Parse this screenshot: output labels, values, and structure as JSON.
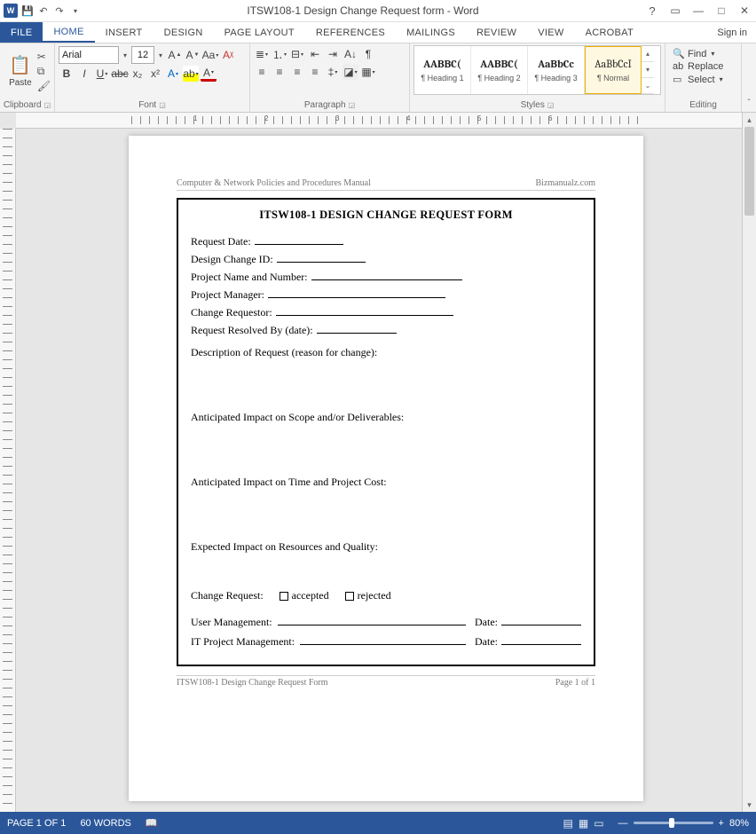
{
  "title": "ITSW108-1 Design Change Request form - Word",
  "window": {
    "help": "?",
    "ropt": "▭",
    "min": "—",
    "max": "□",
    "close": "✕"
  },
  "tabs": {
    "file": "FILE",
    "home": "HOME",
    "insert": "INSERT",
    "design": "DESIGN",
    "pagelayout": "PAGE LAYOUT",
    "references": "REFERENCES",
    "mailings": "MAILINGS",
    "review": "REVIEW",
    "view": "VIEW",
    "acrobat": "ACROBAT",
    "signin": "Sign in"
  },
  "ribbon": {
    "clipboard": {
      "paste": "Paste",
      "label": "Clipboard"
    },
    "font": {
      "name": "Arial",
      "size": "12",
      "label": "Font"
    },
    "paragraph": {
      "label": "Paragraph"
    },
    "styles": {
      "label": "Styles",
      "items": [
        {
          "prev": "AABBC(",
          "name": "¶ Heading 1",
          "bold": true
        },
        {
          "prev": "AABBC(",
          "name": "¶ Heading 2",
          "bold": true
        },
        {
          "prev": "AaBbCc",
          "name": "¶ Heading 3",
          "bold": true
        },
        {
          "prev": "AaBbCcI",
          "name": "¶ Normal",
          "bold": false
        }
      ]
    },
    "editing": {
      "find": "Find",
      "replace": "Replace",
      "select": "Select",
      "label": "Editing"
    }
  },
  "doc": {
    "hdr_left": "Computer & Network Policies and Procedures Manual",
    "hdr_right": "Bizmanualz.com",
    "form_title": "ITSW108-1   DESIGN CHANGE REQUEST FORM",
    "f1": "Request Date:",
    "f2": "Design Change ID:",
    "f3": "Project Name and Number:",
    "f4": "Project Manager:",
    "f5": "Change Requestor:",
    "f6": "Request Resolved By (date):",
    "f7": "Description of Request (reason for change):",
    "s1": "Anticipated Impact on Scope and/or Deliverables:",
    "s2": "Anticipated Impact on Time and Project Cost:",
    "s3": "Expected Impact on Resources and Quality:",
    "cr": "Change Request:",
    "acc": "accepted",
    "rej": "rejected",
    "um": "User Management:",
    "pm": "IT Project Management:",
    "date": "Date:",
    "ftr_left": "ITSW108-1 Design Change Request Form",
    "ftr_right": "Page 1 of 1"
  },
  "status": {
    "page": "PAGE 1 OF 1",
    "words": "60 WORDS",
    "lang": "",
    "zoom": "80%"
  }
}
